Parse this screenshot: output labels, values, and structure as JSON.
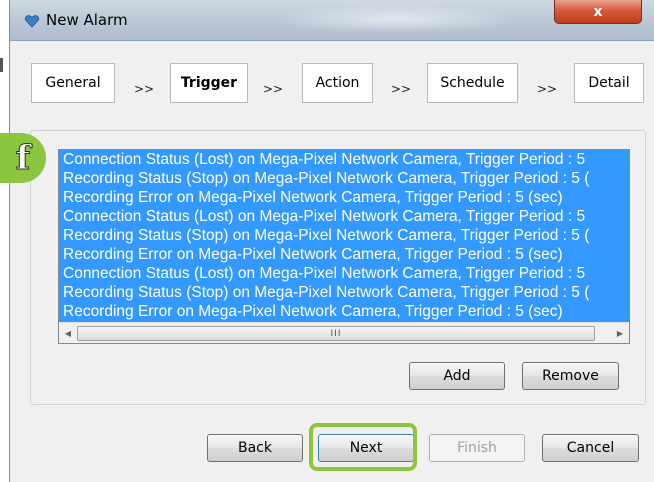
{
  "window": {
    "title": "New Alarm",
    "close_label": "x"
  },
  "steps": [
    {
      "label": "General",
      "active": false
    },
    {
      "label": "Trigger",
      "active": true
    },
    {
      "label": "Action",
      "active": false
    },
    {
      "label": "Schedule",
      "active": false
    },
    {
      "label": "Detail",
      "active": false
    }
  ],
  "step_separator": ">>",
  "trigger_list": {
    "items": [
      "Connection Status (Lost)  on Mega-Pixel Network Camera, Trigger Period : 5",
      "Recording Status (Stop)  on Mega-Pixel Network Camera, Trigger Period : 5 (",
      "Recording Error on Mega-Pixel Network Camera, Trigger Period : 5 (sec)",
      "Connection Status (Lost)  on Mega-Pixel Network Camera, Trigger Period : 5",
      "Recording Status (Stop)  on Mega-Pixel Network Camera, Trigger Period : 5 (",
      "Recording Error on Mega-Pixel Network Camera, Trigger Period : 5 (sec)",
      "Connection Status (Lost)  on Mega-Pixel Network Camera, Trigger Period : 5",
      "Recording Status (Stop)  on Mega-Pixel Network Camera, Trigger Period : 5 (",
      "Recording Error on Mega-Pixel Network Camera, Trigger Period : 5 (sec)"
    ],
    "selection_color": "#3399ff",
    "scrollbar_thumb_grip": "III"
  },
  "list_buttons": {
    "add": "Add",
    "remove": "Remove"
  },
  "footer_buttons": {
    "back": "Back",
    "next": "Next",
    "finish": "Finish",
    "cancel": "Cancel"
  },
  "annotation": {
    "badge_letter": "f",
    "accent_color": "#8cc63f"
  }
}
